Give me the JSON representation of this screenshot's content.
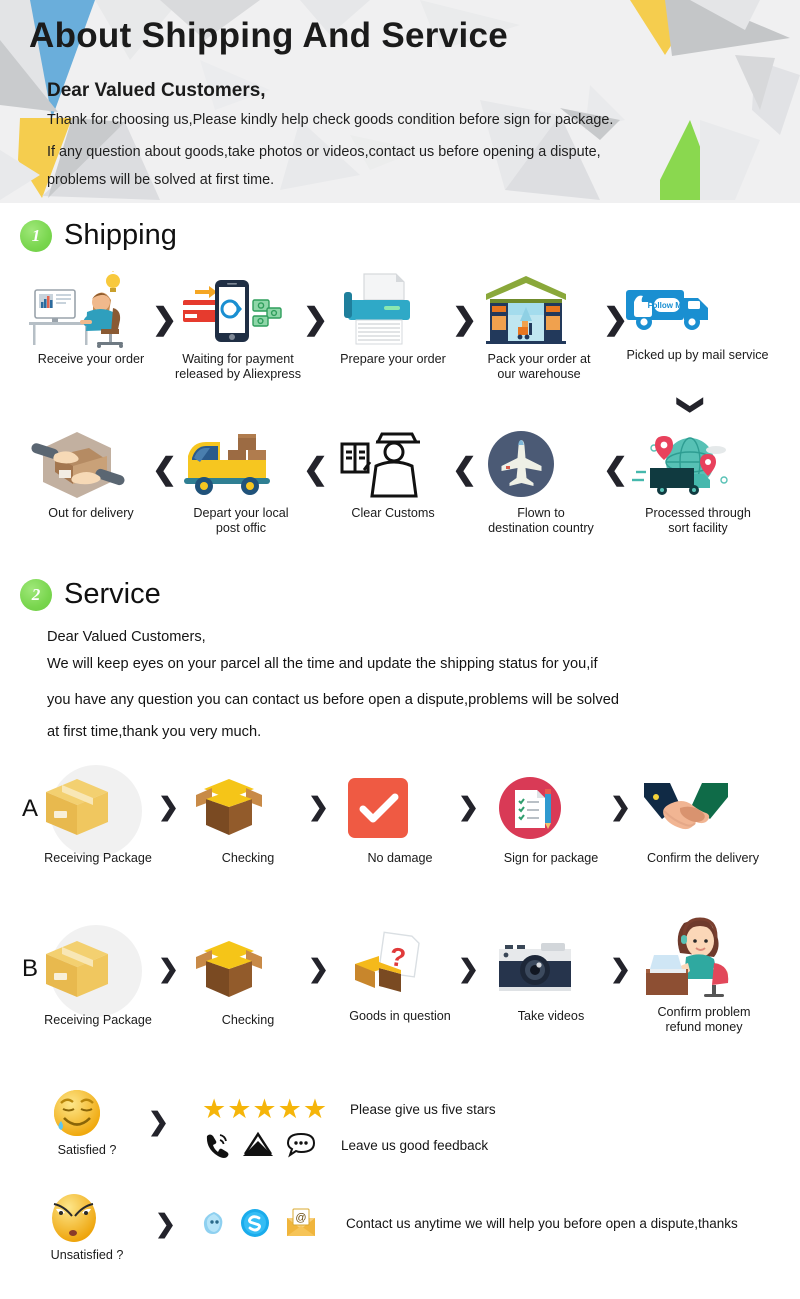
{
  "header": {
    "title": "About Shipping And Service",
    "salutation": "Dear Valued Customers,",
    "line1": "Thank for choosing us,Please kindly help check goods condition before sign for package.",
    "line2": "If any question about goods,take photos or videos,contact us before opening a dispute,",
    "line3": "problems will be solved at first time."
  },
  "sections": [
    {
      "badge": "1",
      "title": "Shipping"
    },
    {
      "badge": "2",
      "title": "Service"
    }
  ],
  "shipping": {
    "row1": [
      {
        "caption": "Receive your order",
        "icon": "desk-worker-icon"
      },
      {
        "caption": "Waiting for payment\nreleased by Aliexpress",
        "icon": "mobile-payment-icon"
      },
      {
        "caption": "Prepare your order",
        "icon": "printer-icon"
      },
      {
        "caption": "Pack your order at\nour warehouse",
        "icon": "warehouse-icon"
      },
      {
        "caption": "Picked up by mail service",
        "icon": "delivery-truck-follow-me-icon"
      }
    ],
    "row2": [
      {
        "caption": "Out for delivery",
        "icon": "hands-package-icon"
      },
      {
        "caption": "Depart your local\npost offic",
        "icon": "yellow-van-icon"
      },
      {
        "caption": "Clear Customs",
        "icon": "customs-officer-icon"
      },
      {
        "caption": "Flown to\ndestination country",
        "icon": "airplane-icon"
      },
      {
        "caption": "Processed through\nsort facility",
        "icon": "globe-truck-icon"
      }
    ],
    "arrow_right": "❯",
    "arrow_left": "❮",
    "arrow_down": "❯"
  },
  "service": {
    "salutation": "Dear Valued Customers,",
    "line1": "We will keep eyes on your parcel all the time and update the shipping status for you,if",
    "line2": "you have any question you can contact us before open a dispute,problems will be solved",
    "line3": "at first time,thank you very much.",
    "rowA": {
      "letter": "A",
      "steps": [
        {
          "caption": "Receiving Package",
          "icon": "closed-box-icon"
        },
        {
          "caption": "Checking",
          "icon": "open-box-icon"
        },
        {
          "caption": "No damage",
          "icon": "red-check-icon"
        },
        {
          "caption": "Sign for package",
          "icon": "sign-document-icon"
        },
        {
          "caption": "Confirm the delivery",
          "icon": "handshake-icon"
        }
      ]
    },
    "rowB": {
      "letter": "B",
      "steps": [
        {
          "caption": "Receiving Package",
          "icon": "closed-box-icon"
        },
        {
          "caption": "Checking",
          "icon": "open-box-icon"
        },
        {
          "caption": "Goods in question",
          "icon": "question-box-icon"
        },
        {
          "caption": "Take videos",
          "icon": "camera-icon"
        },
        {
          "caption": "Confirm problem\nrefund money",
          "icon": "support-agent-icon"
        }
      ]
    },
    "feedback": {
      "satisfied_label": "Satisfied ?",
      "satisfied_icon": "sweating-smile-emoji",
      "stars": "★★★★★",
      "stars_text": "Please give us five stars",
      "contact_icons": [
        "phone-ring-icon",
        "envelope-icon",
        "chat-bubble-icon"
      ],
      "contact_text": "Leave us good feedback"
    },
    "unsatisfied": {
      "label": "Unsatisfied ?",
      "icon": "worried-face-emoji",
      "messenger_icons": [
        "aliexpress-chat-icon",
        "skype-icon",
        "email-at-icon"
      ],
      "text": "Contact us anytime we will help you before open a dispute,thanks"
    }
  },
  "colors": {
    "accent_green": "#7ed957",
    "header_bg": "#f0f0f1",
    "arrow_dark": "#23232b",
    "star_gold": "#f5b50a",
    "red": "#ef5a43",
    "blue": "#1a8fd1"
  }
}
